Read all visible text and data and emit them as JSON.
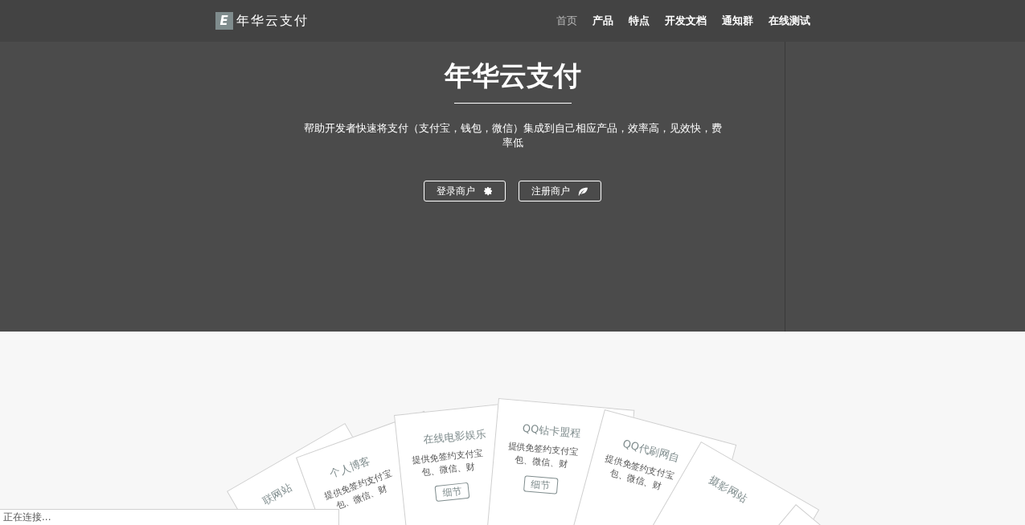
{
  "header": {
    "logo_mark": "E",
    "brand": "年华云支付",
    "nav": [
      {
        "label": "首页",
        "selected": true
      },
      {
        "label": "产品",
        "selected": false
      },
      {
        "label": "特点",
        "selected": false
      },
      {
        "label": "开发文档",
        "selected": false
      },
      {
        "label": "通知群",
        "selected": false
      },
      {
        "label": "在线测试",
        "selected": false
      }
    ]
  },
  "hero": {
    "title": "年华云支付",
    "subtitle": "帮助开发者快速将支付（支付宝，钱包，微信）集成到自己相应产品，效率高，见效快，费率低",
    "buttons": [
      {
        "label": "登录商户"
      },
      {
        "label": "注册商户"
      }
    ]
  },
  "cards": [
    {
      "title": "联网站"
    },
    {
      "title": "个人博客",
      "lines": [
        "提供免签约支付宝",
        "包、微信、财"
      ]
    },
    {
      "title": "在线电影娱乐",
      "lines": [
        "提供免签约支付宝",
        "包、微信、财"
      ],
      "button": "细节"
    },
    {
      "title": "QQ钻卡盟程",
      "lines": [
        "提供免签约支付宝",
        "包、微信、财"
      ],
      "button": "细节"
    },
    {
      "title": "QQ代刷网自",
      "lines": [
        "提供免签约支付宝",
        "包、微信、财"
      ]
    },
    {
      "title": "摄影网站"
    }
  ],
  "status_bar": {
    "text": "正在连接..."
  }
}
